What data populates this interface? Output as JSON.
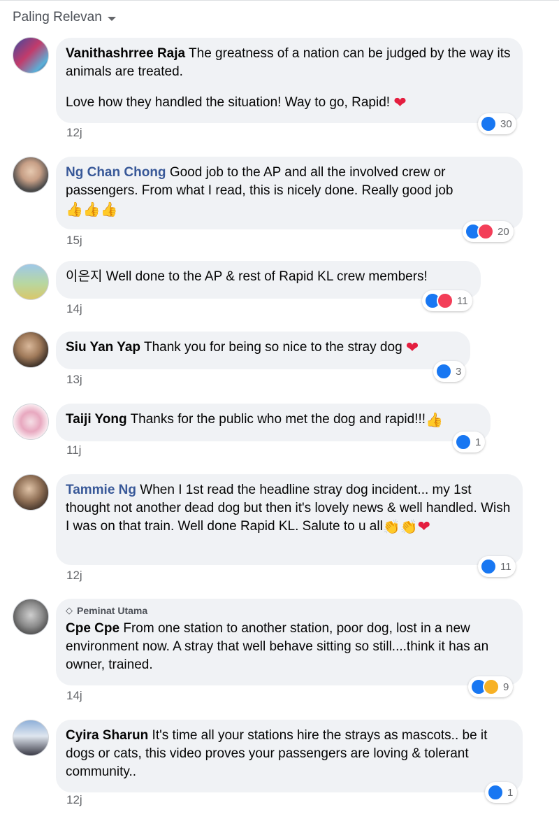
{
  "sort_label": "Paling Relevan",
  "comments": [
    {
      "author": "Vanithashrree Raja",
      "text": "The greatness of a nation can be judged by the way its animals are treated.",
      "text2": "Love how they handled the situation! Way to go, Rapid!",
      "time": "12j",
      "reactions": "30"
    },
    {
      "author": "Ng Chan Chong",
      "text": "Good job to the AP and all the involved crew or passengers. From what I read, this is nicely done. Really good job",
      "time": "15j",
      "reactions": "20"
    },
    {
      "author": "이은지",
      "text": "Well done to the AP & rest of Rapid KL crew members!",
      "time": "14j",
      "reactions": "11"
    },
    {
      "author": "Siu Yan Yap",
      "text": "Thank you for being so nice to the stray dog",
      "time": "13j",
      "reactions": "3"
    },
    {
      "author": "Taiji Yong",
      "text": "Thanks for the public who met the dog and rapid!!!",
      "time": "11j",
      "reactions": "1"
    },
    {
      "author": "Tammie Ng",
      "text": "When I 1st read the headline stray dog incident... my 1st thought not another dead dog but then it's lovely news & well handled. Wish I was on that train. Well done Rapid KL. Salute to u all",
      "time": "12j",
      "reactions": "11"
    },
    {
      "badge": "Peminat Utama",
      "author": "Cpe Cpe",
      "text": "From one station to another station, poor dog, lost in a new environment now. A stray that well behave sitting so still....think it has an owner, trained.",
      "time": "14j",
      "reactions": "9"
    },
    {
      "author": "Cyira Sharun",
      "text": "It's time all your stations hire the strays as mascots.. be it dogs or cats, this video proves your passengers are loving & tolerant community..",
      "time": "12j",
      "reactions": "1"
    }
  ],
  "colors": {
    "like": "#1877f2",
    "love": "#f33e58",
    "sad": "#f7b125",
    "bubble": "#f0f2f5",
    "link": "#385898"
  }
}
